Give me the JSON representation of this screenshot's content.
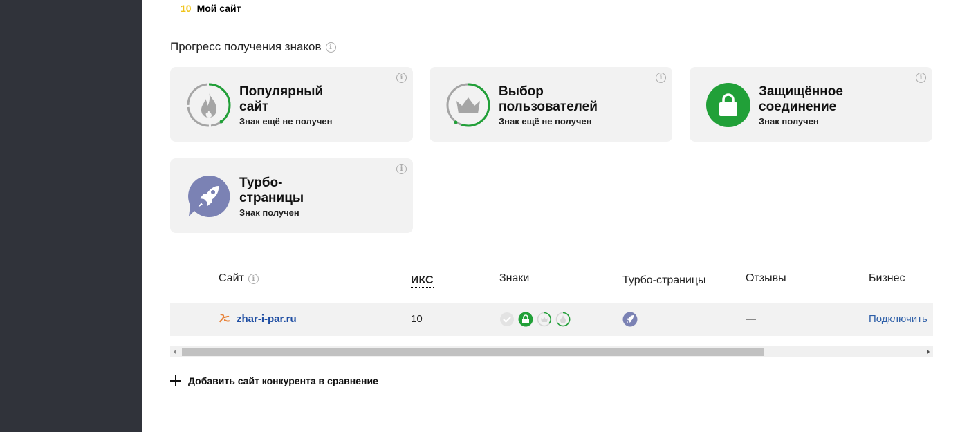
{
  "top": {
    "number": "10",
    "site_name": "Мой сайт"
  },
  "badges_section": {
    "title": "Прогресс получения знаков",
    "cards": [
      {
        "name": "Популярный\nсайт",
        "status": "Знак ещё не получен",
        "icon": "fire-icon",
        "progress": 0.4
      },
      {
        "name": "Выбор\nпользователей",
        "status": "Знак ещё не получен",
        "icon": "crown-icon",
        "progress": 0.55
      },
      {
        "name": "Защищённое\nсоединение",
        "status": "Знак получен",
        "icon": "lock-icon"
      },
      {
        "name": "Турбо-\nстраницы",
        "status": "Знак получен",
        "icon": "rocket-icon"
      }
    ]
  },
  "table": {
    "headers": {
      "site": "Сайт",
      "iks": "ИКС",
      "signs": "Знаки",
      "turbo": "Турбо-страницы",
      "reviews": "Отзывы",
      "business": "Бизнес"
    },
    "rows": [
      {
        "site": "zhar-i-par.ru",
        "iks": "10",
        "reviews": "—",
        "business": "Подключить"
      }
    ]
  },
  "add_competitor": "Добавить сайт конкурента в сравнение",
  "colors": {
    "green": "#21a038",
    "turbo": "#7b82b4",
    "sidebar": "#30333a",
    "link": "#1f4ea3",
    "accent_number": "#f0c419"
  }
}
